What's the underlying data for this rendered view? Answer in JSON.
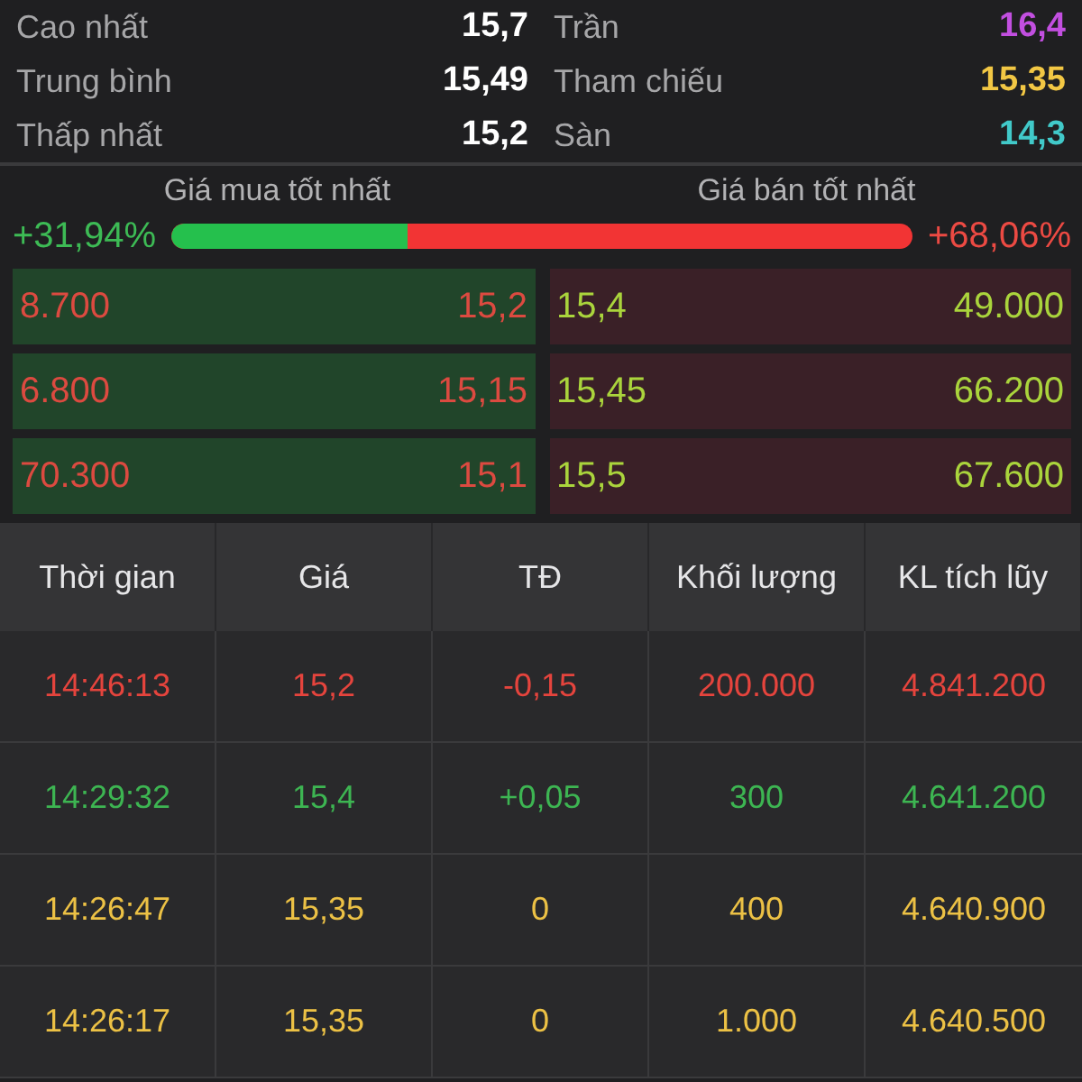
{
  "stats": [
    {
      "label": "Cao nhất",
      "value": "15,7",
      "color": "#ffffff"
    },
    {
      "label": "Trần",
      "value": "16,4",
      "color": "#c24fe0"
    },
    {
      "label": "Trung bình",
      "value": "15,49",
      "color": "#ffffff"
    },
    {
      "label": "Tham chiếu",
      "value": "15,35",
      "color": "#f2c744"
    },
    {
      "label": "Thấp nhất",
      "value": "15,2",
      "color": "#ffffff"
    },
    {
      "label": "Sàn",
      "value": "14,3",
      "color": "#41c9c9"
    }
  ],
  "order_book": {
    "bid_title": "Giá mua tốt nhất",
    "ask_title": "Giá bán tốt nhất",
    "bid_share": "+31,94%",
    "ask_share": "+68,06%",
    "balance": {
      "level": 0.3194
    },
    "rows": [
      {
        "bid": {
          "volume": "8.700",
          "price": "15,2",
          "color": "#dc4a40"
        },
        "ask": {
          "price": "15,4",
          "volume": "49.000",
          "color": "#aad43c"
        }
      },
      {
        "bid": {
          "volume": "6.800",
          "price": "15,15",
          "color": "#dc4a40"
        },
        "ask": {
          "price": "15,45",
          "volume": "66.200",
          "color": "#aad43c"
        }
      },
      {
        "bid": {
          "volume": "70.300",
          "price": "15,1",
          "color": "#dc4a40"
        },
        "ask": {
          "price": "15,5",
          "volume": "67.600",
          "color": "#aad43c"
        }
      }
    ]
  },
  "trades": {
    "columns": [
      "Thời gian",
      "Giá",
      "TĐ",
      "Khối lượng",
      "KL tích lũy"
    ],
    "rows": [
      {
        "color": "#e5443d",
        "cells": [
          "14:46:13",
          "15,2",
          "-0,15",
          "200.000",
          "4.841.200"
        ]
      },
      {
        "color": "#3db552",
        "cells": [
          "14:29:32",
          "15,4",
          "+0,05",
          "300",
          "4.641.200"
        ]
      },
      {
        "color": "#ecc145",
        "cells": [
          "14:26:47",
          "15,35",
          "0",
          "400",
          "4.640.900"
        ]
      },
      {
        "color": "#ecc145",
        "cells": [
          "14:26:17",
          "15,35",
          "0",
          "1.000",
          "4.640.500"
        ]
      }
    ]
  }
}
